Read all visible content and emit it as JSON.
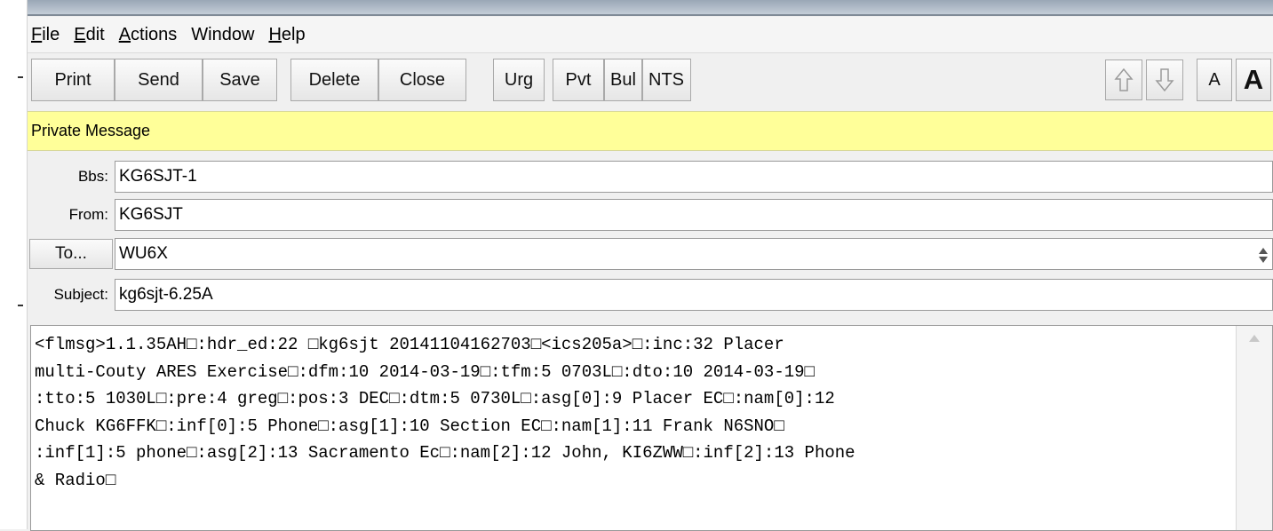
{
  "menu": [
    {
      "mnemonic": "F",
      "rest": "ile"
    },
    {
      "mnemonic": "E",
      "rest": "dit"
    },
    {
      "mnemonic": "A",
      "rest": "ctions"
    },
    {
      "mnemonic": "",
      "rest": "Window"
    },
    {
      "mnemonic": "H",
      "rest": "elp"
    }
  ],
  "toolbar": {
    "print": "Print",
    "send": "Send",
    "save": "Save",
    "delete": "Delete",
    "close": "Close",
    "urg": "Urg",
    "pvt": "Pvt",
    "bul": "Bul",
    "nts": "NTS",
    "font_small": "A",
    "font_large": "A",
    "up_icon": "arrow-up-icon",
    "down_icon": "arrow-down-icon"
  },
  "banner": {
    "text": "Private Message",
    "color": "#ffff99"
  },
  "fields": {
    "bbs": {
      "label": "Bbs:",
      "value": "KG6SJT-1"
    },
    "from": {
      "label": "From:",
      "value": "KG6SJT"
    },
    "to": {
      "label": "To...",
      "value": "WU6X"
    },
    "subject": {
      "label": "Subject:",
      "value": "kg6sjt-6.25A"
    }
  },
  "message_body": "<flmsg>1.1.35AH□:hdr_ed:22 □kg6sjt 20141104162703□<ics205a>□:inc:32 Placer\nmulti-Couty ARES Exercise□:dfm:10 2014-03-19□:tfm:5 0703L□:dto:10 2014-03-19□\n:tto:5 1030L□:pre:4 greg□:pos:3 DEC□:dtm:5 0730L□:asg[0]:9 Placer EC□:nam[0]:12\nChuck KG6FFK□:inf[0]:5 Phone□:asg[1]:10 Section EC□:nam[1]:11 Frank N6SNO□\n:inf[1]:5 phone□:asg[2]:13 Sacramento Ec□:nam[2]:12 John, KI6ZWW□:inf[2]:13 Phone\n& Radio□"
}
